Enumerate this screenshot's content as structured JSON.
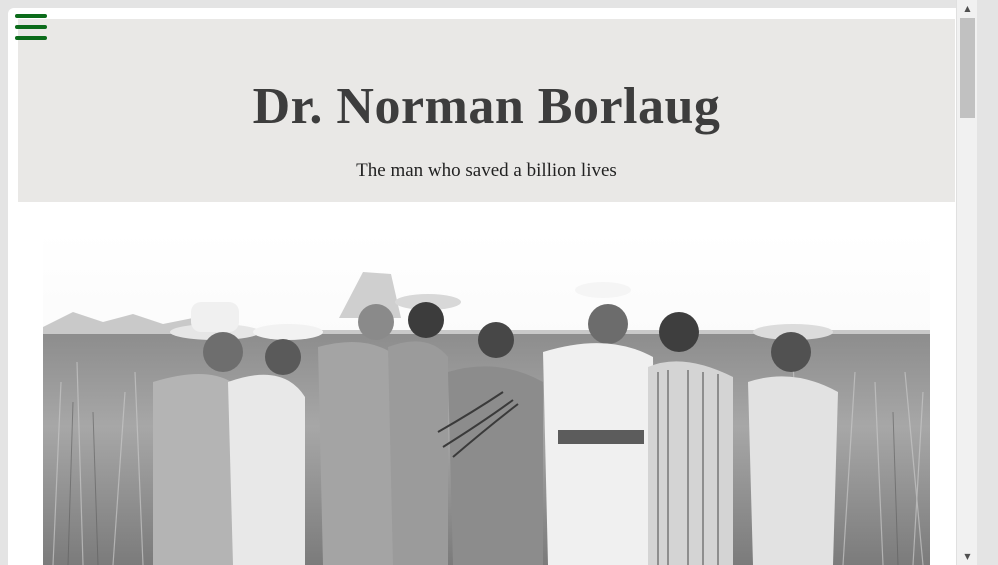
{
  "menu": {
    "icon": "hamburger-menu-icon"
  },
  "header": {
    "title": "Dr. Norman Borlaug",
    "subtitle": "The man who saved a billion lives"
  },
  "photo": {
    "icon": "photograph"
  },
  "colors": {
    "accent": "#0b6b1a",
    "header_bg": "#e9e8e6",
    "title": "#3d3d3d"
  }
}
